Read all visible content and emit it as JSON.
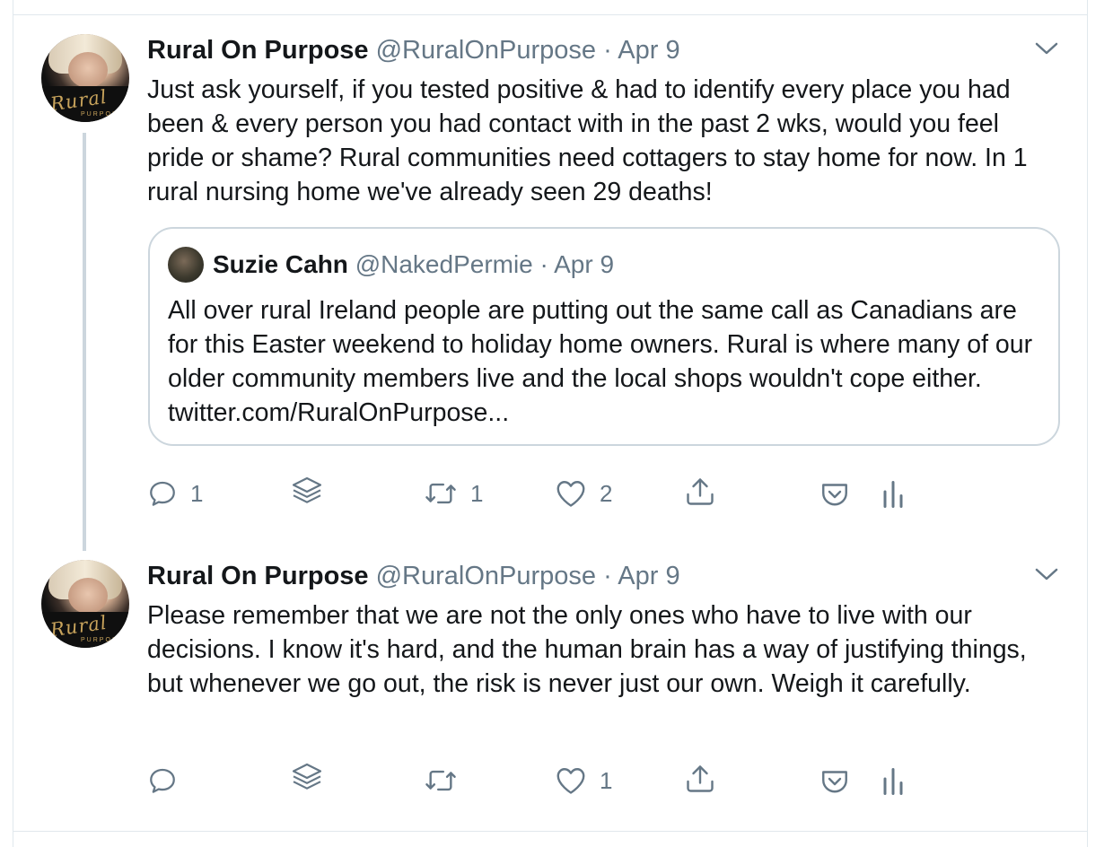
{
  "tweets": [
    {
      "author_name": "Rural On Purpose",
      "author_handle": "@RuralOnPurpose",
      "separator": "·",
      "date": "Apr 9",
      "avatar_text": "Rural",
      "avatar_subtext": "PURPOSE",
      "text": "Just ask yourself, if you tested positive & had to identify every place you had been & every person you had contact with in the past 2 wks, would you feel pride or shame? Rural communities need cottagers to stay home for now. In 1 rural nursing home we've already seen 29 deaths!",
      "quoted": {
        "author_name": "Suzie Cahn",
        "author_handle": "@NakedPermie",
        "separator": "·",
        "date": "Apr 9",
        "text": "All over rural Ireland people are putting out the same call as Canadians are for this Easter weekend to holiday home owners. Rural is where many of our older community members live and the local shops wouldn't cope either. twitter.com/RuralOnPurpose..."
      },
      "actions": {
        "reply_count": "1",
        "retweet_count": "1",
        "like_count": "2"
      }
    },
    {
      "author_name": "Rural On Purpose",
      "author_handle": "@RuralOnPurpose",
      "separator": "·",
      "date": "Apr 9",
      "avatar_text": "Rural",
      "avatar_subtext": "PURPOSE",
      "text": "Please remember that we are not the only ones who have to live with our decisions. I know it's hard, and the human brain has a way of justifying things, but whenever we go out, the risk is never just our own. Weigh it carefully.",
      "actions": {
        "reply_count": "",
        "retweet_count": "",
        "like_count": "1"
      }
    }
  ],
  "colors": {
    "primary_text": "#14171a",
    "secondary_text": "#657786",
    "border": "#e1e8ed",
    "thread_line": "#ccd6dd"
  },
  "icons": [
    "reply-icon",
    "layers-icon",
    "retweet-icon",
    "like-icon",
    "share-icon",
    "pocket-icon",
    "analytics-icon",
    "chevron-down-icon"
  ]
}
